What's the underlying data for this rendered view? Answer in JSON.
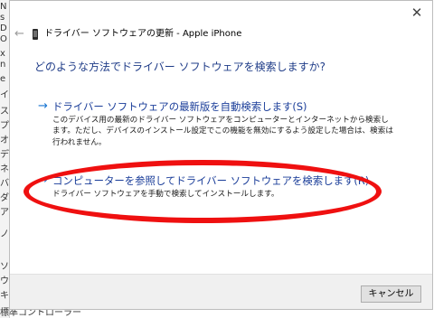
{
  "background": {
    "fragments": [
      "N",
      "s",
      "D",
      "O",
      "x",
      "n",
      "e",
      "イ",
      "ス",
      "プ",
      "オ",
      "デ",
      "ネ",
      "バ",
      "ダ",
      "ア",
      "ノ",
      "ソ",
      "ウ",
      "キ"
    ],
    "bottom_text": "標準コントローラー"
  },
  "dialog": {
    "title": "ドライバー ソフトウェアの更新 - Apple iPhone",
    "close_glyph": "✕",
    "back_glyph": "←",
    "heading": "どのような方法でドライバー ソフトウェアを検索しますか?",
    "options": [
      {
        "arrow": "→",
        "title": "ドライバー ソフトウェアの最新版を自動検索します(S)",
        "description": "このデバイス用の最新のドライバー ソフトウェアをコンピューターとインターネットから検索します。ただし、デバイスのインストール設定でこの機能を無効にするよう設定した場合は、検索は行われません。"
      },
      {
        "arrow": "→",
        "title": "コンピューターを参照してドライバー ソフトウェアを検索します(R)",
        "description": "ドライバー ソフトウェアを手動で検索してインストールします。"
      }
    ],
    "cancel_label": "キャンセル"
  },
  "colors": {
    "heading": "#1f3c88",
    "link": "#1a3d99",
    "arrow": "#1976d2",
    "annotation_ring": "#ef1010"
  }
}
